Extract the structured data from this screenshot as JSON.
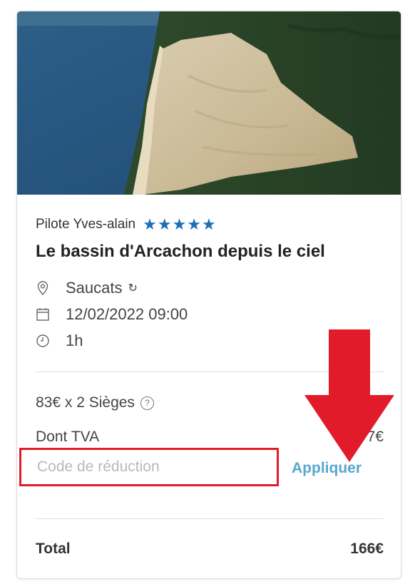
{
  "pilot": {
    "name": "Pilote Yves-alain",
    "stars": "★★★★★"
  },
  "flight": {
    "title": "Le bassin d'Arcachon depuis le ciel",
    "location": "Saucats",
    "datetime": "12/02/2022 09:00",
    "duration": "1h"
  },
  "pricing": {
    "seats_line": "83€ x 2 Sièges",
    "tva_label": "Dont TVA",
    "tva_value": "7€",
    "total_label": "Total",
    "total_value": "166€"
  },
  "discount": {
    "placeholder": "Code de réduction",
    "value": "",
    "apply_label": "Appliquer"
  },
  "colors": {
    "star_blue": "#1a6fb8",
    "annotation_red": "#e21b2b",
    "link_blue": "#5aa6cc"
  },
  "icons": {
    "location": "map-pin-icon",
    "date": "calendar-icon",
    "duration": "clock-icon",
    "help": "question-circle-icon",
    "refresh": "refresh-icon"
  }
}
